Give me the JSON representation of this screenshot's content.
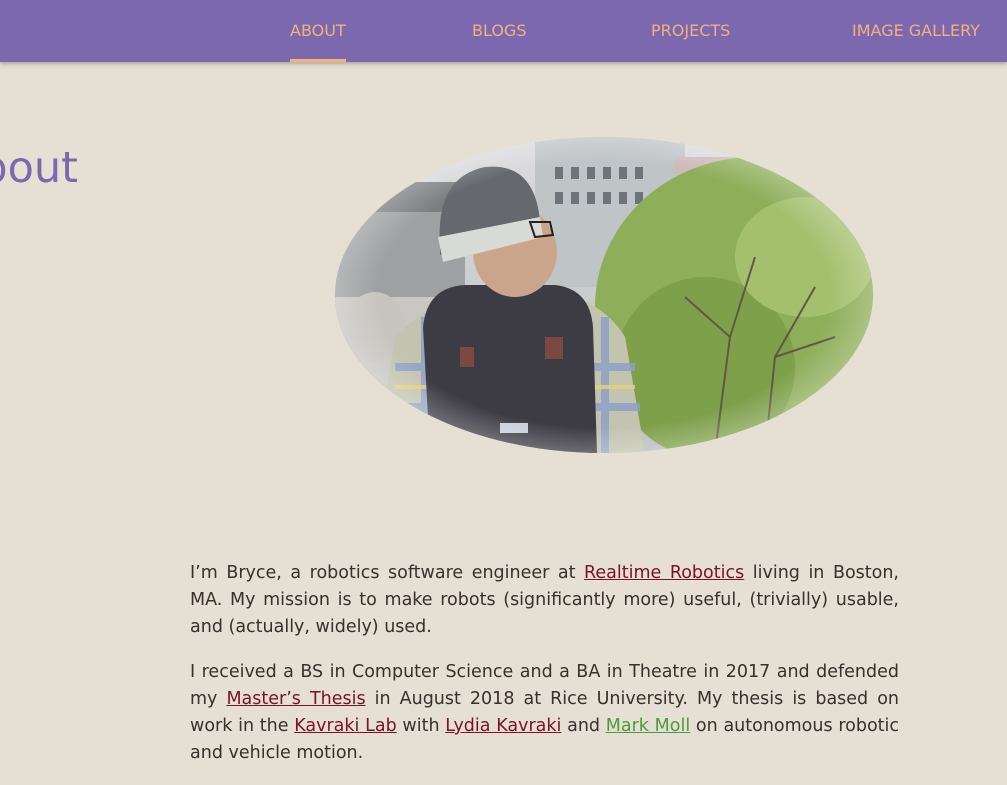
{
  "nav": {
    "items": [
      {
        "label": "ABOUT",
        "active": true
      },
      {
        "label": "BLOGS",
        "active": false
      },
      {
        "label": "PROJECTS",
        "active": false
      },
      {
        "label": "IMAGE GALLERY",
        "active": false
      }
    ]
  },
  "page": {
    "title": "About"
  },
  "colors": {
    "nav_bg": "#7b68ae",
    "nav_text": "#f4b07d",
    "page_bg": "#e5dfd4",
    "title": "#7b68ae",
    "body_text": "#3a2f2a",
    "link": "#7a1326",
    "link_visited": "#4f9a3a"
  },
  "bio": {
    "p1": {
      "t1": "I’m Bryce, a robotics software engineer at ",
      "link1": "Realtime Robotics",
      "t2": " living in Boston, MA. My mission is to make robots (significantly more) useful, (trivially) usable, and (actually, widely) used."
    },
    "p2": {
      "t1": "I received a BS in Computer Science and a BA in Theatre in 2017 and defended my ",
      "link1": "Master’s Thesis",
      "t2": " in August 2018 at Rice University. My thesis is based on work in the ",
      "link2": "Kavraki Lab",
      "t3": " with ",
      "link3": "Lydia Kavraki",
      "t4": " and ",
      "link4": "Mark Moll",
      "t5": " on autonomous robotic and vehicle motion."
    }
  }
}
